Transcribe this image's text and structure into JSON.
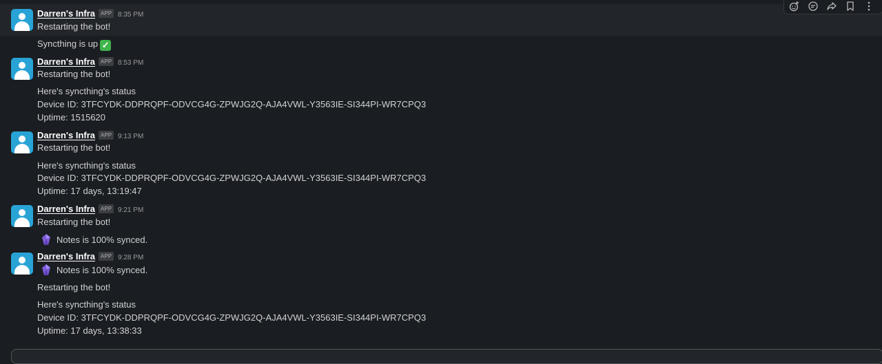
{
  "messages": [
    {
      "sender": "Darren's Infra",
      "badge": "APP",
      "time": "8:35 PM",
      "lines": [
        "Restarting the bot!"
      ]
    },
    {
      "continuation": true,
      "line": "Syncthing is up"
    },
    {
      "sender": "Darren's Infra",
      "badge": "APP",
      "time": "8:53 PM",
      "lines": [
        "Restarting the bot!",
        "Here's syncthing's status",
        "Device ID: 3TFCYDK-DDPRQPF-ODVCG4G-ZPWJG2Q-AJA4VWL-Y3563IE-SI344PI-WR7CPQ3",
        "Uptime: 1515620"
      ]
    },
    {
      "sender": "Darren's Infra",
      "badge": "APP",
      "time": "9:13 PM",
      "lines": [
        "Restarting the bot!",
        "Here's syncthing's status",
        "Device ID: 3TFCYDK-DDPRQPF-ODVCG4G-ZPWJG2Q-AJA4VWL-Y3563IE-SI344PI-WR7CPQ3",
        "Uptime: 17 days, 13:19:47"
      ]
    },
    {
      "sender": "Darren's Infra",
      "badge": "APP",
      "time": "9:21 PM",
      "lines": [
        "Restarting the bot!",
        "Notes is 100% synced."
      ]
    },
    {
      "sender": "Darren's Infra",
      "badge": "APP",
      "time": "9:28 PM",
      "lines": [
        "Notes is 100% synced.",
        "Restarting the bot!",
        "Here's syncthing's status",
        "Device ID: 3TFCYDK-DDPRQPF-ODVCG4G-ZPWJG2Q-AJA4VWL-Y3563IE-SI344PI-WR7CPQ3",
        "Uptime: 17 days, 13:38:33"
      ]
    }
  ],
  "icons": {
    "check": "check-mark-emoji",
    "gem": "purple-gem-emoji"
  },
  "toolbar": [
    "add-reaction-icon",
    "reply-in-thread-icon",
    "forward-icon",
    "bookmark-icon",
    "more-actions-icon"
  ],
  "colors": {
    "avatar": "#29a3d6",
    "background": "#1a1d21",
    "check": "#3fb54a"
  }
}
